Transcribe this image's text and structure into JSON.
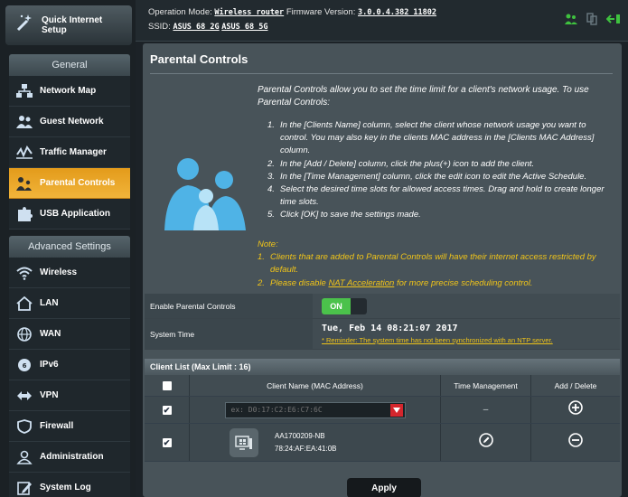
{
  "sidebar": {
    "quick_setup": "Quick Internet Setup",
    "general_title": "General",
    "general_items": [
      {
        "label": "Network Map",
        "icon": "network-map-icon"
      },
      {
        "label": "Guest Network",
        "icon": "guest-network-icon"
      },
      {
        "label": "Traffic Manager",
        "icon": "traffic-manager-icon"
      },
      {
        "label": "Parental Controls",
        "icon": "parental-controls-icon",
        "active": true
      },
      {
        "label": "USB Application",
        "icon": "puzzle-icon"
      }
    ],
    "advanced_title": "Advanced Settings",
    "advanced_items": [
      {
        "label": "Wireless",
        "icon": "wifi-icon"
      },
      {
        "label": "LAN",
        "icon": "home-icon"
      },
      {
        "label": "WAN",
        "icon": "globe-icon"
      },
      {
        "label": "IPv6",
        "icon": "ipv6-globe-icon"
      },
      {
        "label": "VPN",
        "icon": "vpn-icon"
      },
      {
        "label": "Firewall",
        "icon": "shield-icon"
      },
      {
        "label": "Administration",
        "icon": "user-icon"
      },
      {
        "label": "System Log",
        "icon": "edit-log-icon"
      }
    ]
  },
  "topbar": {
    "op_mode_label": "Operation Mode:",
    "op_mode_value": "Wireless router",
    "fw_label": "Firmware Version:",
    "fw_value": "3.0.0.4.382_11802",
    "ssid_label": "SSID:",
    "ssid_1": "ASUS_68_2G",
    "ssid_2": "ASUS_68_5G"
  },
  "main": {
    "title": "Parental Controls",
    "intro": "Parental Controls allow you to set the time limit for a client's network usage. To use Parental Controls:",
    "steps": [
      {
        "n": "1.",
        "text": "In the [Clients Name] column, select the client whose network usage you want to control. You may also key in the clients MAC address in the [Clients MAC Address] column."
      },
      {
        "n": "2.",
        "text": "In the [Add / Delete] column, click the plus(+) icon to add the client."
      },
      {
        "n": "3.",
        "text": "In the [Time Management] column, click the edit icon to edit the Active Schedule."
      },
      {
        "n": "4.",
        "text": "Select the desired time slots for allowed access times. Drag and hold to create longer time slots."
      },
      {
        "n": "5.",
        "text": "Click [OK] to save the settings made."
      }
    ],
    "note_label": "Note:",
    "note_1_n": "1.",
    "note_1": "Clients that are added to Parental Controls will have their internet access restricted by default.",
    "note_2_n": "2.",
    "note_2_pre": "Please disable",
    "note_2_link": "NAT Acceleration",
    "note_2_post": "for more precise scheduling control."
  },
  "settings": {
    "enable_label": "Enable Parental Controls",
    "toggle_text": "ON",
    "system_time_label": "System Time",
    "system_time_value": "Tue, Feb 14 08:21:07 2017",
    "reminder": "* Reminder: The system time has not been synchronized with an NTP server."
  },
  "client_list": {
    "title": "Client List (Max Limit : 16)",
    "col_name": "Client Name (MAC Address)",
    "col_time": "Time Management",
    "col_add": "Add / Delete",
    "input_placeholder": "ex: D0:17:C2:E6:C7:6C",
    "time_placeholder": "–",
    "client_name": "AA1700209-NB",
    "client_mac": "78:24:AF:EA:41:0B"
  },
  "apply_label": "Apply",
  "colors": {
    "accent": "#f0b02a",
    "on_green": "#4bc24b",
    "note_yellow": "#f0c419"
  }
}
